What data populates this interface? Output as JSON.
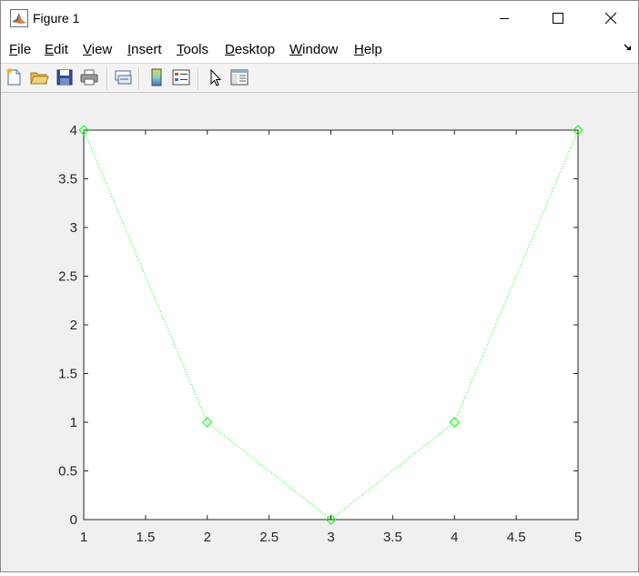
{
  "window": {
    "title": "Figure 1",
    "icon": "matlab-icon",
    "controls": [
      "minimize-icon",
      "maximize-icon",
      "close-icon"
    ]
  },
  "menu": {
    "file": {
      "u": "F",
      "rest": "ile"
    },
    "edit": {
      "u": "E",
      "rest": "dit"
    },
    "view": {
      "u": "V",
      "rest": "iew"
    },
    "insert": {
      "u": "I",
      "rest": "nsert"
    },
    "tools": {
      "u": "T",
      "rest": "ools"
    },
    "desktop": {
      "u": "D",
      "rest": "esktop"
    },
    "window": {
      "u": "W",
      "rest": "indow"
    },
    "help": {
      "u": "H",
      "rest": "elp"
    }
  },
  "toolbar": {
    "icons": [
      "new-figure-icon",
      "open-file-icon",
      "save-icon",
      "print-icon",
      "link-plot-icon",
      "insert-colorbar-icon",
      "insert-legend-icon",
      "edit-plot-icon",
      "property-inspector-icon"
    ]
  },
  "chart_data": {
    "type": "line",
    "x": [
      1,
      2,
      3,
      4,
      5
    ],
    "series": [
      {
        "values": [
          4,
          1,
          0,
          1,
          4
        ],
        "color": "#00ff00",
        "line_style": "dotted",
        "marker": "diamond"
      }
    ],
    "xlim": [
      1,
      5
    ],
    "ylim": [
      0,
      4
    ],
    "xticks": [
      "1",
      "1.5",
      "2",
      "2.5",
      "3",
      "3.5",
      "4",
      "4.5",
      "5"
    ],
    "yticks": [
      "0",
      "0.5",
      "1",
      "1.5",
      "2",
      "2.5",
      "3",
      "3.5",
      "4"
    ],
    "grid": false,
    "title": "",
    "xlabel": "",
    "ylabel": ""
  }
}
